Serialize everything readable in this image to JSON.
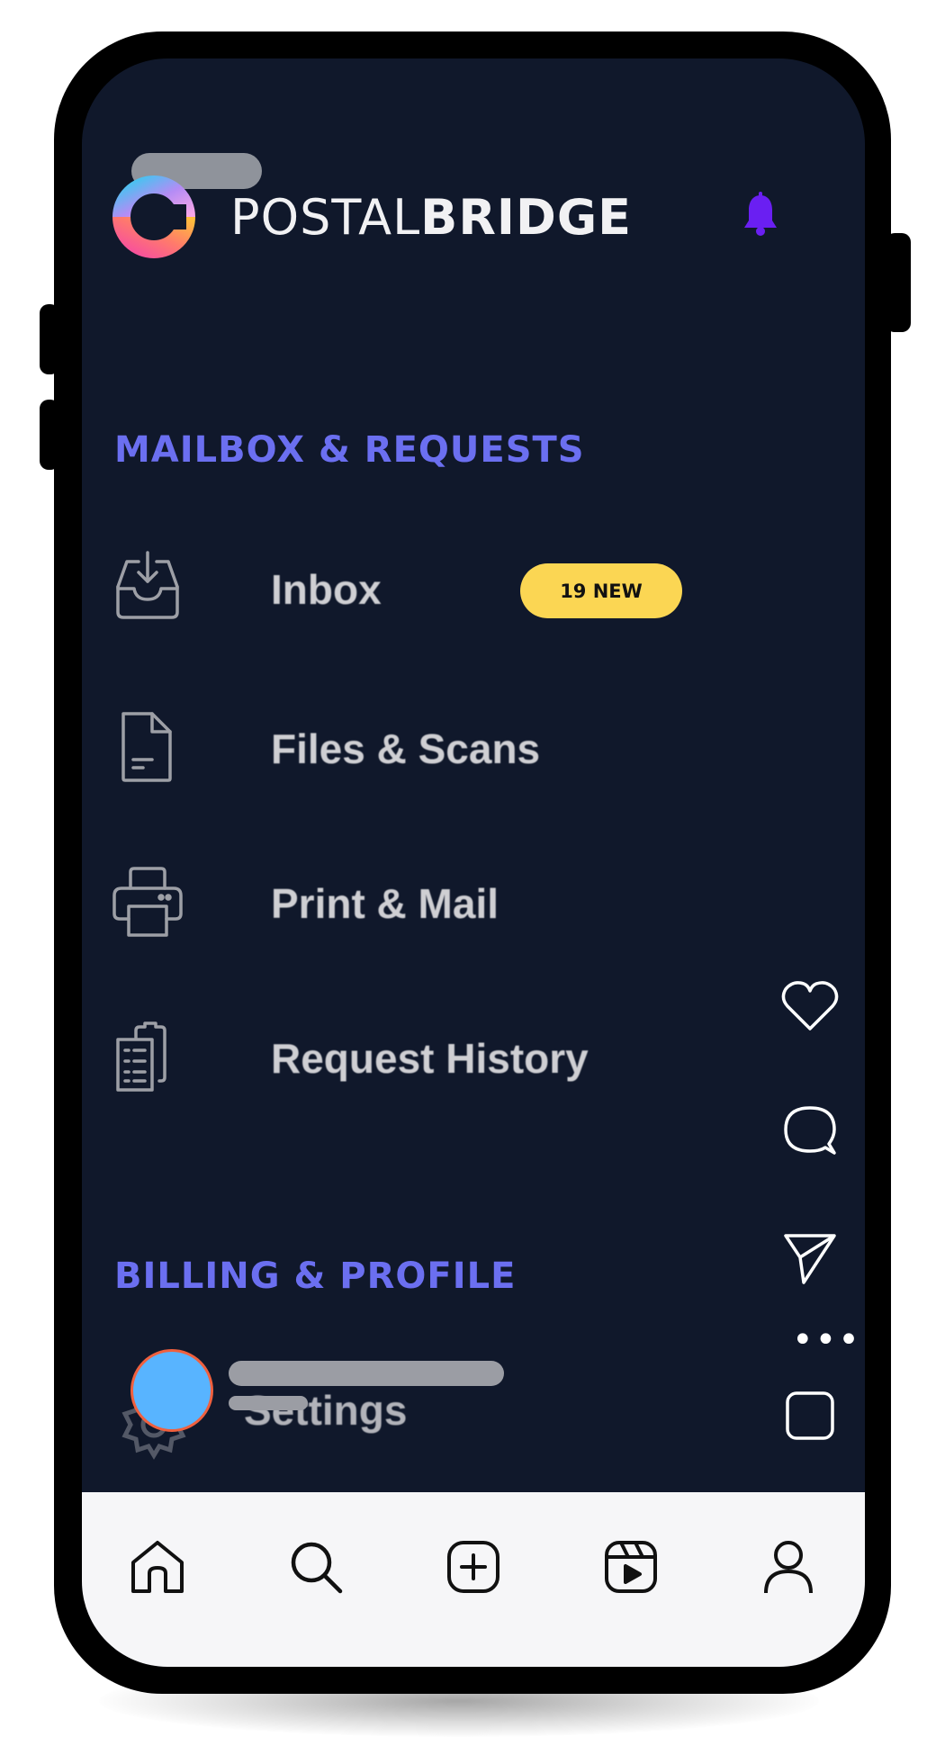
{
  "app": {
    "brand_light": "POSTAL",
    "brand_bold": "BRIDGE"
  },
  "sections": {
    "mailbox": {
      "title": "MAILBOX & REQUESTS",
      "items": [
        {
          "label": "Inbox",
          "icon": "inbox-icon"
        },
        {
          "label": "Files & Scans",
          "icon": "file-icon"
        },
        {
          "label": "Print & Mail",
          "icon": "printer-icon"
        },
        {
          "label": "Request History",
          "icon": "clipboard-icon"
        }
      ]
    },
    "billing": {
      "title": "BILLING & PROFILE",
      "items": [
        {
          "label": "Settings",
          "icon": "gear-icon"
        }
      ]
    }
  },
  "inbox_badge": "19 NEW",
  "actions": {
    "more": "•••"
  },
  "bottom_nav": [
    "home-icon",
    "search-icon",
    "add-icon",
    "reels-icon",
    "profile-icon"
  ],
  "colors": {
    "background": "#10182b",
    "section_title": "#6b6ff0",
    "badge": "#fbd653",
    "bell": "#6a1ff2",
    "avatar": "#58b4ff"
  }
}
